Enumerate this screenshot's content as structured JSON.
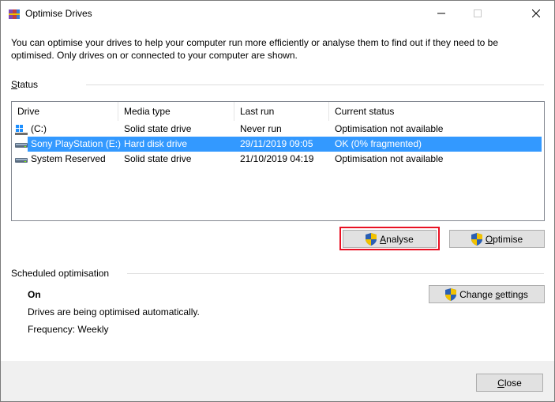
{
  "window": {
    "title": "Optimise Drives",
    "controls": {
      "minimize": "—",
      "maximize": "☐",
      "close": "✕"
    }
  },
  "description": "You can optimise your drives to help your computer run more efficiently or analyse them to find out if they need to be optimised. Only drives on or connected to your computer are shown.",
  "status": {
    "group_label_prefix": "S",
    "group_label_rest": "tatus",
    "columns": [
      "Drive",
      "Media type",
      "Last run",
      "Current status"
    ],
    "rows": [
      {
        "drive": "(C:)",
        "media": "Solid state drive",
        "last_run": "Never run",
        "status": "Optimisation not available",
        "icon": "windows-drive-icon",
        "selected": false
      },
      {
        "drive": "Sony PlayStation (E:)",
        "media": "Hard disk drive",
        "last_run": "29/11/2019 09:05",
        "status": "OK (0% fragmented)",
        "icon": "hard-drive-icon",
        "selected": true
      },
      {
        "drive": "System Reserved",
        "media": "Solid state drive",
        "last_run": "21/10/2019 04:19",
        "status": "Optimisation not available",
        "icon": "hard-drive-icon",
        "selected": false
      }
    ]
  },
  "buttons": {
    "analyse_prefix": "A",
    "analyse_rest": "nalyse",
    "optimise_prefix": "O",
    "optimise_rest": "ptimise",
    "change_settings_prefix": "Change ",
    "change_settings_key": "s",
    "change_settings_rest": "ettings",
    "close_prefix": "C",
    "close_rest": "lose"
  },
  "scheduled": {
    "label": "Scheduled optimisation",
    "state": "On",
    "line1": "Drives are being optimised automatically.",
    "line2": "Frequency: Weekly"
  },
  "colors": {
    "selection": "#3399ff",
    "focus_highlight": "#e81123",
    "shield_blue": "#2a5fb4",
    "shield_yellow": "#f2c200"
  }
}
